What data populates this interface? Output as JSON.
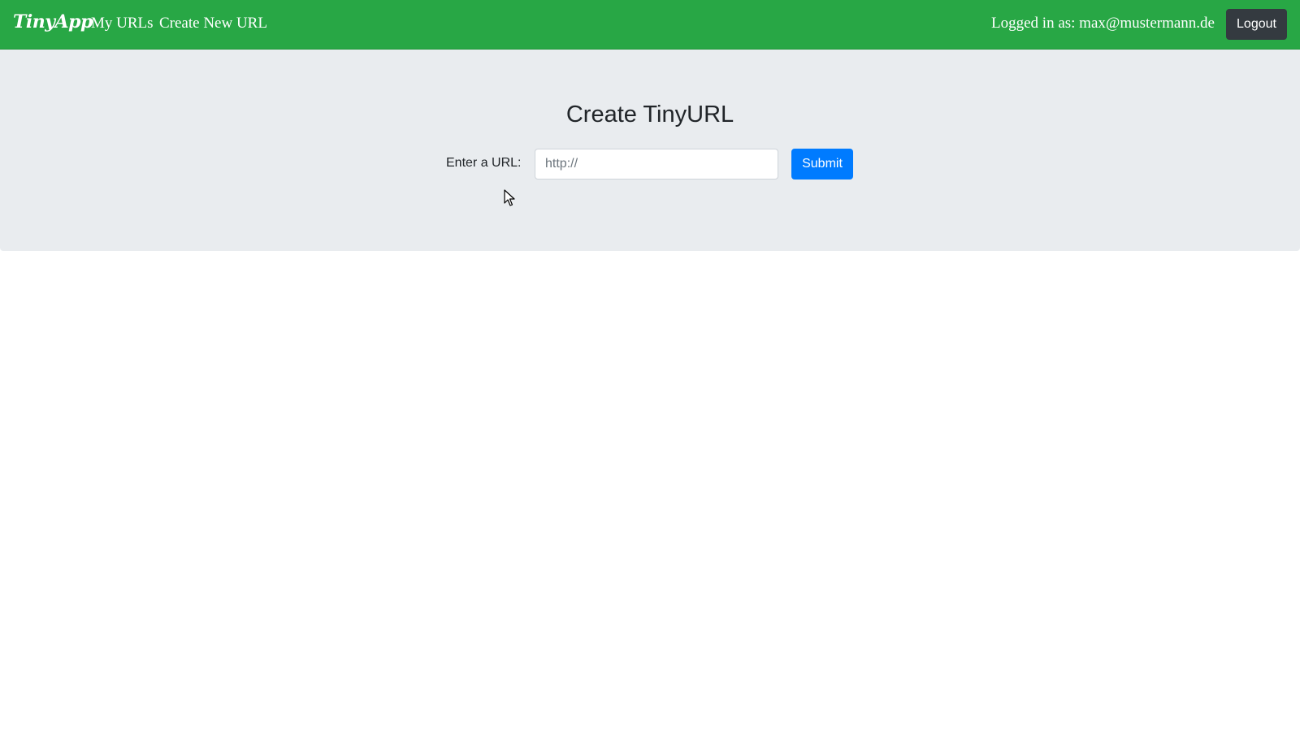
{
  "navbar": {
    "brand": "TinyApp",
    "links": {
      "my_urls": "My URLs",
      "create_new_url": "Create New URL"
    },
    "logged_in_text": "Logged in as: max@mustermann.de",
    "logout_label": "Logout",
    "bg_color": "#28a745"
  },
  "main": {
    "title": "Create TinyURL",
    "form": {
      "label": "Enter a URL:",
      "placeholder": "http://",
      "value": "",
      "submit_label": "Submit"
    },
    "bg_color": "#e9ecef",
    "accent_color": "#007bff"
  }
}
